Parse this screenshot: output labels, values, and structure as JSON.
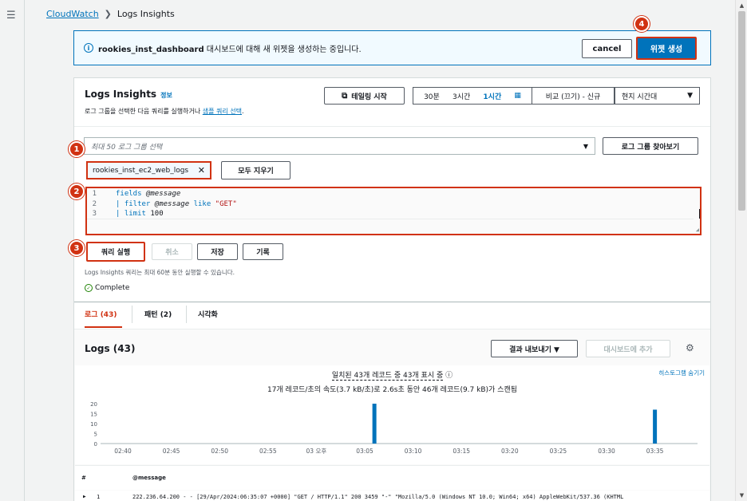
{
  "breadcrumb": {
    "link": "CloudWatch",
    "sep": "❯",
    "current": "Logs Insights"
  },
  "banner": {
    "info_icon": "i",
    "dashboard_name": "rookies_inst_dashboard",
    "message": " 대시보드에 대해 새 위젯을 생성하는 중입니다.",
    "cancel_label": "cancel",
    "create_label": "위젯 생성"
  },
  "header": {
    "title": "Logs Insights",
    "info_link": "정보",
    "desc_prefix": "로그 그룹을 선택한 다음 쿼리를 실행하거나 ",
    "desc_link": "샘플 쿼리 선택",
    "desc_suffix": ".",
    "tail_label": "테일링 시작",
    "time_options": [
      "30분",
      "3시간",
      "1시간"
    ],
    "compare_label": "비교 (끄기) - 신규",
    "timezone_label": "현지 시간대"
  },
  "log_group": {
    "placeholder": "최대 50 로그 그룹 선택",
    "browse_label": "로그 그룹 찾아보기",
    "selected_token": "rookies_inst_ec2_web_logs",
    "clear_all_label": "모두 지우기"
  },
  "query": {
    "lines": [
      {
        "no": "1",
        "kw": "fields",
        "rest_var": "@message",
        "rest_str": "",
        "rest_num": ""
      },
      {
        "no": "2",
        "kw": "| filter",
        "rest_var": "@message",
        "rest_str": "\"GET\"",
        "rest_num": ""
      },
      {
        "no": "3",
        "kw": "| limit",
        "rest_var": "",
        "rest_str": "",
        "rest_num": "100"
      }
    ],
    "like_kw": "like"
  },
  "actions": {
    "run_label": "쿼리 실행",
    "cancel_label": "취소",
    "save_label": "저장",
    "history_label": "기록",
    "note": "Logs Insights 쿼리는 최대 60분 동안 실행할 수 있습니다.",
    "status": "Complete"
  },
  "tabs": [
    {
      "label": "로그 (43)"
    },
    {
      "label": "패턴 (2)"
    },
    {
      "label": "시각화"
    }
  ],
  "results": {
    "title": "Logs (43)",
    "export_label": "결과 내보내기 ▼",
    "add_dashboard_label": "대시보드에 추가",
    "histogram_toggle": "히스토그램 숨기기",
    "summary_line1": "일치된 43개 레코드 중 43개 표시 중",
    "summary_line2": "17개 레코드/초의 속도(3.7 kB/초)로 2.6s초 동안 46개 레코드(9.7 kB)가 스캔됨",
    "col_num": "#",
    "col_message": "@message",
    "row": {
      "num": "1",
      "message": "222.236.64.200 - - [29/Apr/2024:06:35:07 +0000] \"GET / HTTP/1.1\" 200 3459 \"-\" \"Mozilla/5.0 (Windows NT 10.0; Win64; x64) AppleWebKit/537.36 (KHTML"
    }
  },
  "chart_data": {
    "type": "bar",
    "categories": [
      "02:40",
      "02:45",
      "02:50",
      "02:55",
      "03 오후",
      "03:05",
      "03:10",
      "03:15",
      "03:20",
      "03:25",
      "03:30",
      "03:35"
    ],
    "y_ticks": [
      "20",
      "15",
      "10",
      "5",
      "0"
    ],
    "ylim": [
      0,
      20
    ],
    "bars": [
      {
        "x": "03:06",
        "value": 20
      },
      {
        "x": "03:35",
        "value": 17
      }
    ],
    "color": "#0073bb"
  },
  "steps": [
    "1",
    "2",
    "3",
    "4"
  ]
}
